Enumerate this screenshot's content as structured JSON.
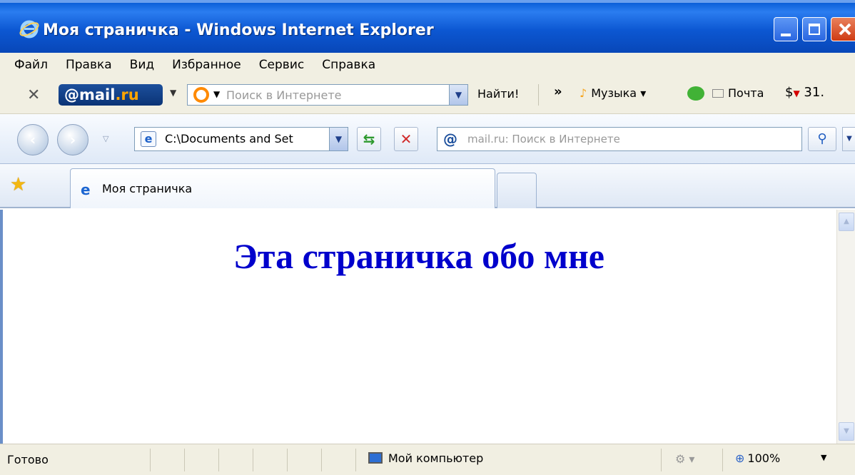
{
  "window": {
    "title": "Моя страничка - Windows Internet Explorer",
    "accent": "#0c57d2"
  },
  "menu": {
    "items": [
      "Файл",
      "Правка",
      "Вид",
      "Избранное",
      "Сервис",
      "Справка"
    ]
  },
  "mailru_toolbar": {
    "logo_main": "@mail",
    "logo_domain": ".ru",
    "search_placeholder": "Поиск в Интернете",
    "find_label": "Найти!",
    "more_label": "»",
    "music_label": "Музыка ▾",
    "mail_label": "Почта",
    "currency_label": "31."
  },
  "navigation": {
    "address": "C:\\Documents and Set",
    "search_placeholder": "mail.ru: Поиск в Интернете"
  },
  "tabs": {
    "active_label": "Моя страничка"
  },
  "page": {
    "heading": "Эта страничка обо мне",
    "heading_color": "#0000cc"
  },
  "statusbar": {
    "status": "Готово",
    "zone": "Мой компьютер",
    "zoom": "100%"
  }
}
